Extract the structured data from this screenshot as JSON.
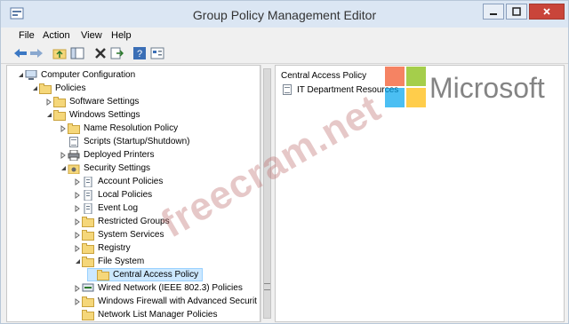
{
  "window": {
    "title": "Group Policy Management Editor",
    "icons": [
      "app-icon",
      "minimize-icon",
      "maximize-icon",
      "close-icon"
    ]
  },
  "menubar": {
    "items": [
      "File",
      "Action",
      "View",
      "Help"
    ]
  },
  "toolbar": {
    "icons": [
      "back-arrow-icon",
      "forward-arrow-icon",
      "up-folder-icon",
      "show-hide-tree-icon",
      "delete-icon",
      "export-icon",
      "help-icon",
      "properties-icon"
    ]
  },
  "tree": {
    "items": [
      {
        "label": "Computer Configuration",
        "icon": "computer-icon",
        "expander": "expanded"
      },
      {
        "label": "Policies",
        "icon": "folder-icon",
        "expander": "expanded"
      },
      {
        "label": "Software Settings",
        "icon": "folder-icon",
        "expander": "collapsed"
      },
      {
        "label": "Windows Settings",
        "icon": "folder-icon",
        "expander": "expanded"
      },
      {
        "label": "Name Resolution Policy",
        "icon": "folder-icon",
        "expander": "collapsed"
      },
      {
        "label": "Scripts (Startup/Shutdown)",
        "icon": "document-icon",
        "expander": "none"
      },
      {
        "label": "Deployed Printers",
        "icon": "printer-icon",
        "expander": "collapsed"
      },
      {
        "label": "Security Settings",
        "icon": "security-settings-icon",
        "expander": "expanded"
      },
      {
        "label": "Account Policies",
        "icon": "policy-icon",
        "expander": "collapsed"
      },
      {
        "label": "Local Policies",
        "icon": "policy-icon",
        "expander": "collapsed"
      },
      {
        "label": "Event Log",
        "icon": "policy-icon",
        "expander": "collapsed"
      },
      {
        "label": "Restricted Groups",
        "icon": "folder-icon",
        "expander": "collapsed"
      },
      {
        "label": "System Services",
        "icon": "folder-icon",
        "expander": "collapsed"
      },
      {
        "label": "Registry",
        "icon": "folder-icon",
        "expander": "collapsed"
      },
      {
        "label": "File System",
        "icon": "folder-icon",
        "expander": "expanded"
      },
      {
        "label": "Central Access Policy",
        "icon": "folder-icon",
        "expander": "none",
        "selected": true
      },
      {
        "label": "Wired Network (IEEE 802.3) Policies",
        "icon": "network-icon",
        "expander": "collapsed"
      },
      {
        "label": "Windows Firewall with Advanced Securit",
        "icon": "folder-icon",
        "expander": "collapsed"
      },
      {
        "label": "Network List Manager Policies",
        "icon": "folder-icon",
        "expander": "none"
      }
    ]
  },
  "content": {
    "header": "Central Access Policy",
    "items": [
      {
        "label": "IT Department Resources",
        "icon": "document-icon"
      }
    ]
  },
  "watermark": {
    "text": "freecram.net",
    "logo_text": "Microsoft"
  },
  "colors": {
    "titlebar": "#dbe6f3",
    "close_button": "#c9453a",
    "selection": "#cce8ff",
    "ms_red": "#f25022",
    "ms_green": "#7fba00",
    "ms_blue": "#00a4ef",
    "ms_yellow": "#ffb900"
  }
}
